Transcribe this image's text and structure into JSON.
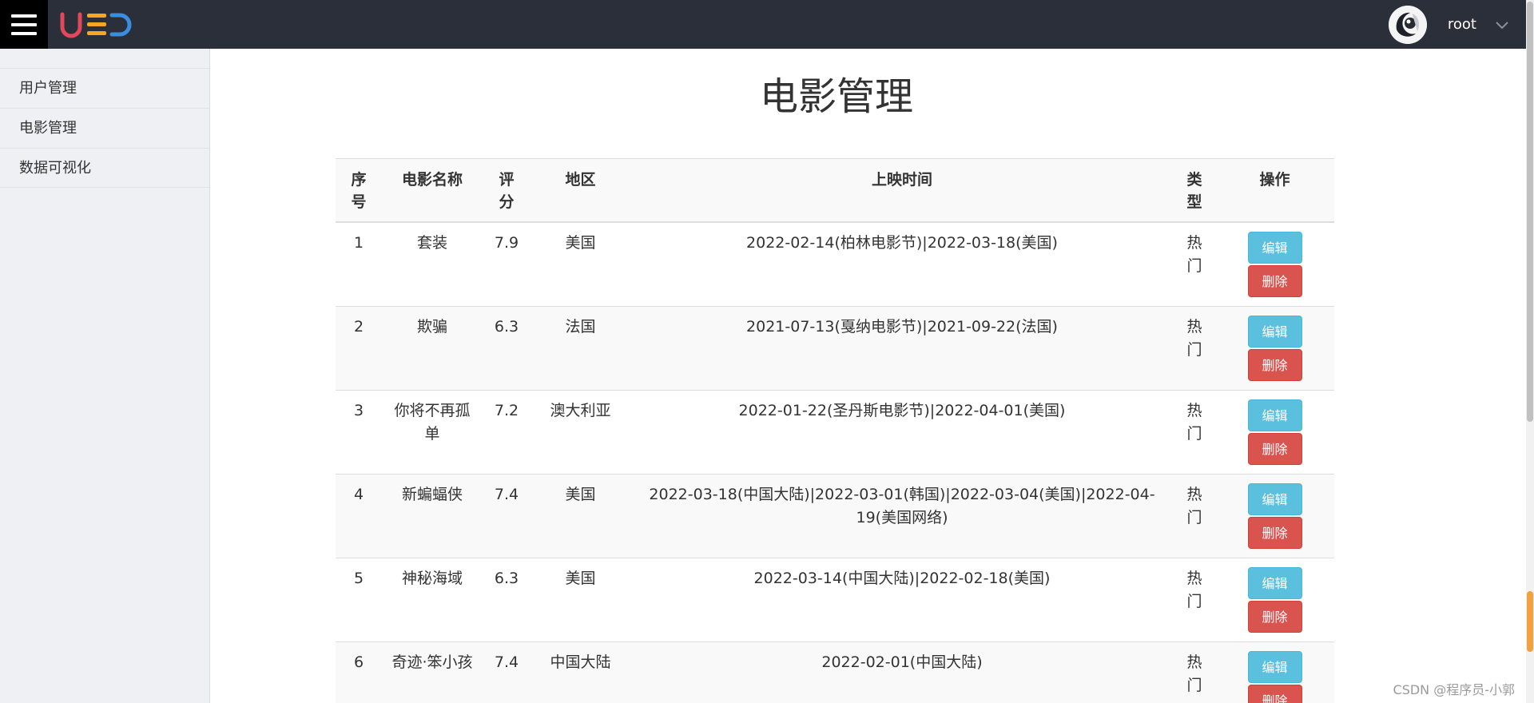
{
  "header": {
    "logo_text": "UED",
    "username": "root",
    "colors": {
      "bar": "#2b2f3a",
      "logo_u": "#e2475c",
      "logo_e": "#f5a623",
      "logo_d": "#3b8de0"
    }
  },
  "sidebar": {
    "items": [
      {
        "label": "用户管理"
      },
      {
        "label": "电影管理"
      },
      {
        "label": "数据可视化"
      }
    ]
  },
  "page": {
    "title": "电影管理"
  },
  "table": {
    "columns": [
      "序号",
      "电影名称",
      "评分",
      "地区",
      "上映时间",
      "类型",
      "操作"
    ],
    "edit_label": "编辑",
    "delete_label": "删除",
    "rows": [
      {
        "idx": "1",
        "name": "套装",
        "score": "7.9",
        "region": "美国",
        "date": "2022-02-14(柏林电影节)|2022-03-18(美国)",
        "type": "热门"
      },
      {
        "idx": "2",
        "name": "欺骗",
        "score": "6.3",
        "region": "法国",
        "date": "2021-07-13(戛纳电影节)|2021-09-22(法国)",
        "type": "热门"
      },
      {
        "idx": "3",
        "name": "你将不再孤单",
        "score": "7.2",
        "region": "澳大利亚",
        "date": "2022-01-22(圣丹斯电影节)|2022-04-01(美国)",
        "type": "热门"
      },
      {
        "idx": "4",
        "name": "新蝙蝠侠",
        "score": "7.4",
        "region": "美国",
        "date": "2022-03-18(中国大陆)|2022-03-01(韩国)|2022-03-04(美国)|2022-04-19(美国网络)",
        "type": "热门"
      },
      {
        "idx": "5",
        "name": "神秘海域",
        "score": "6.3",
        "region": "美国",
        "date": "2022-03-14(中国大陆)|2022-02-18(美国)",
        "type": "热门"
      },
      {
        "idx": "6",
        "name": "奇迹·笨小孩",
        "score": "7.4",
        "region": "中国大陆",
        "date": "2022-02-01(中国大陆)",
        "type": "热门"
      }
    ]
  },
  "watermark": "CSDN @程序员-小郭"
}
